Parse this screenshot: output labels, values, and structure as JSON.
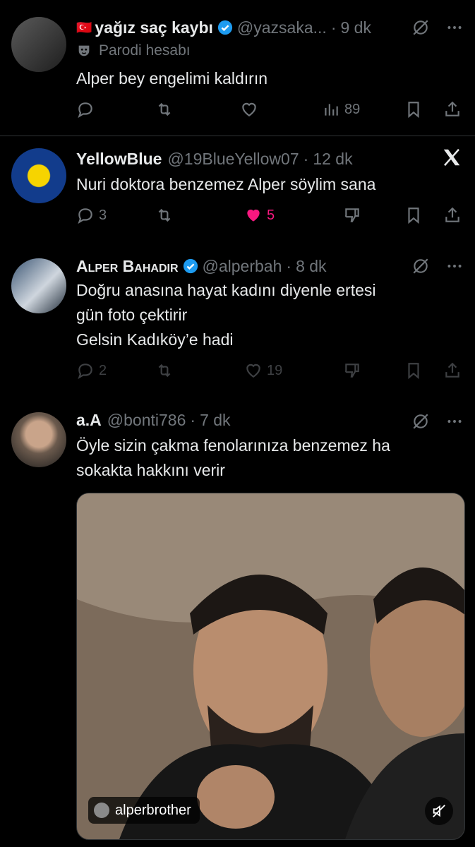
{
  "tweets": [
    {
      "flag": "🇹🇷",
      "name": "yağız saç kaybı",
      "handle": "@yazsaka...",
      "time": "9 dk",
      "parody_label": "Parodi hesabı",
      "text": "Alper bey engelimi kaldırın",
      "views": "89"
    },
    {
      "name": "YellowBlue",
      "handle": "@19BlueYellow07",
      "time": "12 dk",
      "text": "Nuri doktora benzemez Alper söylim sana",
      "replies": "3",
      "likes": "5"
    },
    {
      "name": "Alper Bahadır",
      "handle": "@alperbah",
      "time": "8 dk",
      "text_lines": [
        "Doğru anasına hayat kadını diyenle ertesi",
        "gün foto çektirir",
        "Gelsin Kadıköy’e hadi"
      ],
      "replies": "2",
      "likes": "19"
    },
    {
      "name": "a.A",
      "handle": "@bonti786",
      "time": "7 dk",
      "text_lines": [
        "Öyle sizin çakma fenolarınıza benzemez ha",
        "sokakta hakkını verir"
      ],
      "media_tag": "alperbrother"
    }
  ],
  "colors": {
    "background": "#000000",
    "text": "#e7e9ea",
    "muted": "#71767b",
    "verified": "#1d9bf0",
    "like": "#f91880",
    "separator": "#2f3336"
  }
}
